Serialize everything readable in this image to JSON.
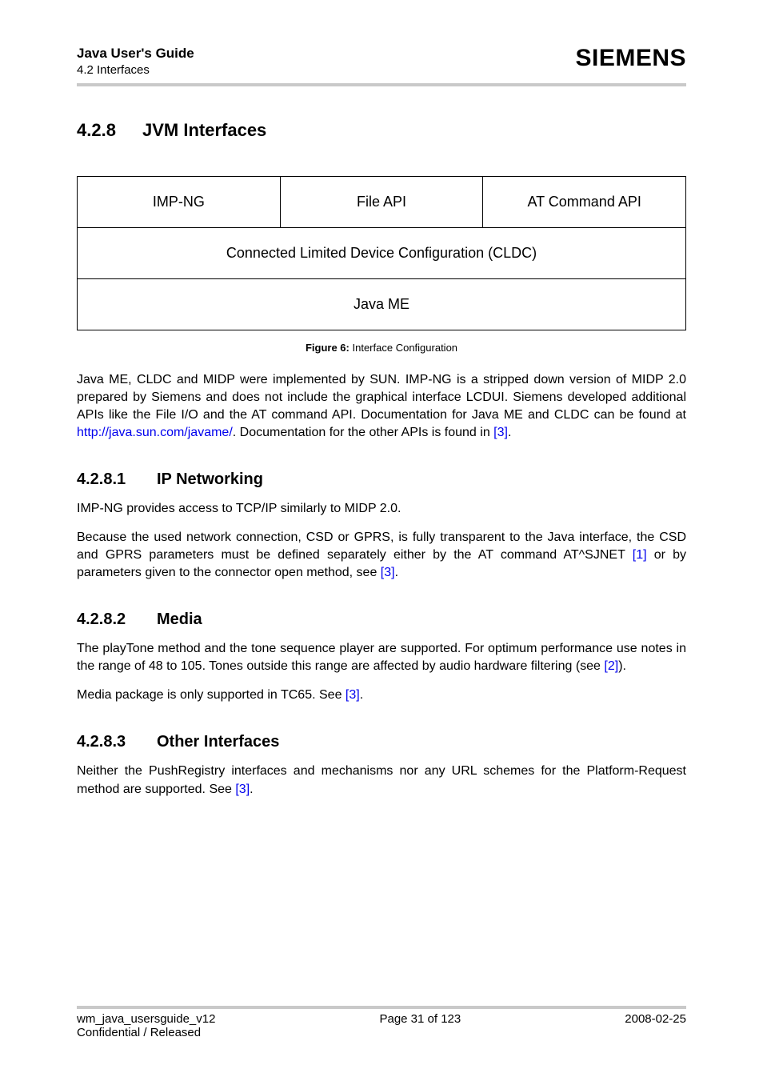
{
  "header": {
    "title": "Java User's Guide",
    "section": "4.2 Interfaces",
    "logo": "SIEMENS"
  },
  "section_428": {
    "number": "4.2.8",
    "title": "JVM Interfaces"
  },
  "diagram": {
    "row1": {
      "c1": "IMP-NG",
      "c2": "File API",
      "c3": "AT Command API"
    },
    "row2": "Connected Limited Device Configuration (CLDC)",
    "row3": "Java ME"
  },
  "fig6": {
    "label": "Figure 6:",
    "text": "Interface Configuration"
  },
  "para_intro": {
    "t1": "Java ME, CLDC and MIDP were implemented by SUN. IMP-NG is a stripped down version of MIDP 2.0 prepared by Siemens and does not include the graphical interface LCDUI. Siemens developed additional APIs like the File I/O and the AT command API. Documentation for Java ME and CLDC can be found at ",
    "link1": "http://java.sun.com/javame/",
    "t2": ". Documentation for the other APIs is found in ",
    "ref3": "[3]",
    "t3": "."
  },
  "section_4281": {
    "number": "4.2.8.1",
    "title": "IP Networking",
    "p1": "IMP-NG provides access to TCP/IP similarly to MIDP 2.0.",
    "p2a": "Because the used network connection, CSD or GPRS, is fully transparent to the Java interface, the CSD and GPRS parameters must be defined separately either by the AT command AT^SJNET ",
    "ref1": "[1]",
    "p2b": " or by parameters given to the connector open method, see ",
    "ref3": "[3]",
    "p2c": "."
  },
  "section_4282": {
    "number": "4.2.8.2",
    "title": "Media",
    "p1a": "The playTone method and the tone sequence player are supported. For optimum performance use notes in the range of 48 to 105. Tones outside this range are affected by audio hardware filtering (see ",
    "ref2": "[2]",
    "p1b": ").",
    "p2a": "Media package is only supported in TC65. See ",
    "ref3": "[3]",
    "p2b": "."
  },
  "section_4283": {
    "number": "4.2.8.3",
    "title": "Other Interfaces",
    "p1a": "Neither the PushRegistry interfaces and mechanisms nor any URL schemes for the Platform-Request method are supported. See ",
    "ref3": "[3]",
    "p1b": "."
  },
  "footer": {
    "left1": "wm_java_usersguide_v12",
    "left2": "Confidential / Released",
    "center": "Page 31 of 123",
    "right": "2008-02-25"
  }
}
